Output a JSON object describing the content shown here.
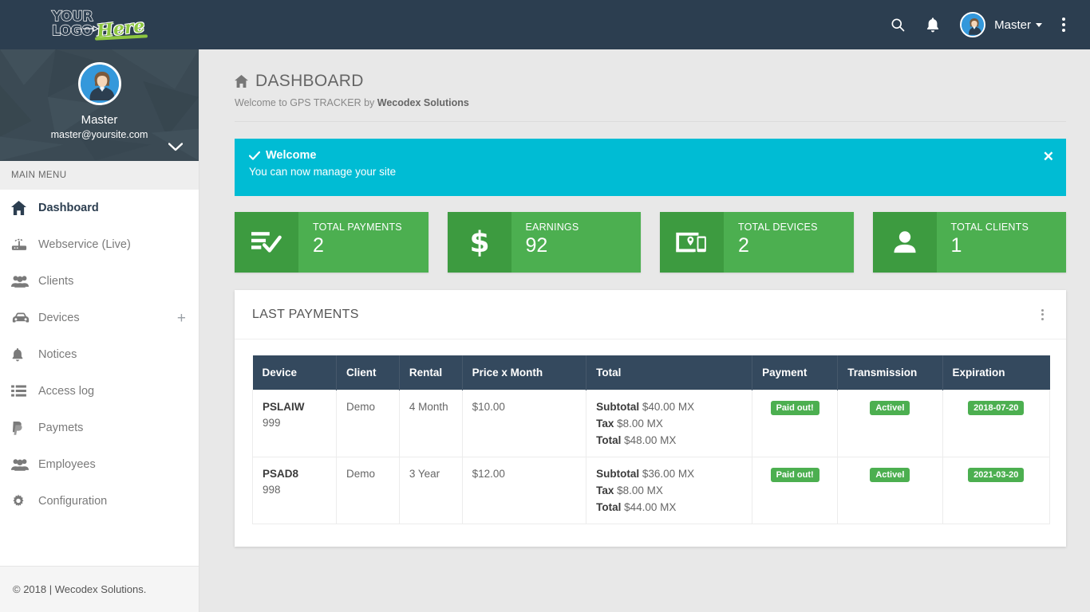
{
  "navbar": {
    "logo_line1": "YOUR",
    "logo_line2": "LOGO",
    "logo_accent": "Here",
    "search_icon": "search-icon",
    "bell_icon": "bell-icon",
    "user_name": "Master",
    "kebab_icon": "vertical-dots-icon"
  },
  "sidebar": {
    "profile": {
      "name": "Master",
      "email": "master@yoursite.com"
    },
    "menu_heading": "MAIN MENU",
    "items": [
      {
        "label": "Dashboard",
        "icon": "home-icon",
        "active": true,
        "plus": ""
      },
      {
        "label": "Webservice (Live)",
        "icon": "router-icon",
        "active": false,
        "plus": ""
      },
      {
        "label": "Clients",
        "icon": "users-icon",
        "active": false,
        "plus": ""
      },
      {
        "label": "Devices",
        "icon": "car-icon",
        "active": false,
        "plus": "+"
      },
      {
        "label": "Notices",
        "icon": "bell-icon",
        "active": false,
        "plus": ""
      },
      {
        "label": "Access log",
        "icon": "list-icon",
        "active": false,
        "plus": ""
      },
      {
        "label": "Paymets",
        "icon": "paypal-icon",
        "active": false,
        "plus": ""
      },
      {
        "label": "Employees",
        "icon": "users-icon",
        "active": false,
        "plus": ""
      },
      {
        "label": "Configuration",
        "icon": "gear-icon",
        "active": false,
        "plus": ""
      }
    ],
    "footer": "© 2018 | Wecodex Solutions."
  },
  "page": {
    "title": "DASHBOARD",
    "title_icon": "home-icon",
    "subtitle_prefix": "Welcome to GPS TRACKER by ",
    "subtitle_brand": "Wecodex Solutions"
  },
  "alert": {
    "title": "Welcome",
    "body": "You can now manage your site",
    "close_label": "✕",
    "color": "#00bcd4"
  },
  "cards": [
    {
      "label": "TOTAL PAYMENTS",
      "value": "2",
      "icon": "list-check-icon"
    },
    {
      "label": "EARNINGS",
      "value": "92",
      "icon": "dollar-icon"
    },
    {
      "label": "TOTAL DEVICES",
      "value": "2",
      "icon": "devices-icon"
    },
    {
      "label": "TOTAL CLIENTS",
      "value": "1",
      "icon": "person-icon"
    }
  ],
  "card_color": "#4caf50",
  "card_icon_color": "#3d9b40",
  "panel": {
    "title": "LAST PAYMENTS",
    "kebab_icon": "vertical-dots-icon"
  },
  "table": {
    "columns": [
      "Device",
      "Client",
      "Rental",
      "Price x Month",
      "Total",
      "Payment",
      "Transmission",
      "Expiration"
    ],
    "rows": [
      {
        "device_code": "PSLAIW",
        "device_num": "999",
        "client": "Demo",
        "rental": "4 Month",
        "price": "$10.00",
        "subtotal_label": "Subtotal",
        "subtotal_value": "$40.00 MX",
        "tax_label": "Tax",
        "tax_value": "$8.00 MX",
        "total_label": "Total",
        "total_value": "$48.00 MX",
        "payment": "Paid out!",
        "transmission": "Activel",
        "expiration": "2018-07-20"
      },
      {
        "device_code": "PSAD8",
        "device_num": "998",
        "client": "Demo",
        "rental": "3 Year",
        "price": "$12.00",
        "subtotal_label": "Subtotal",
        "subtotal_value": "$36.00 MX",
        "tax_label": "Tax",
        "tax_value": "$8.00 MX",
        "total_label": "Total",
        "total_value": "$44.00 MX",
        "payment": "Paid out!",
        "transmission": "Activel",
        "expiration": "2021-03-20"
      }
    ]
  }
}
